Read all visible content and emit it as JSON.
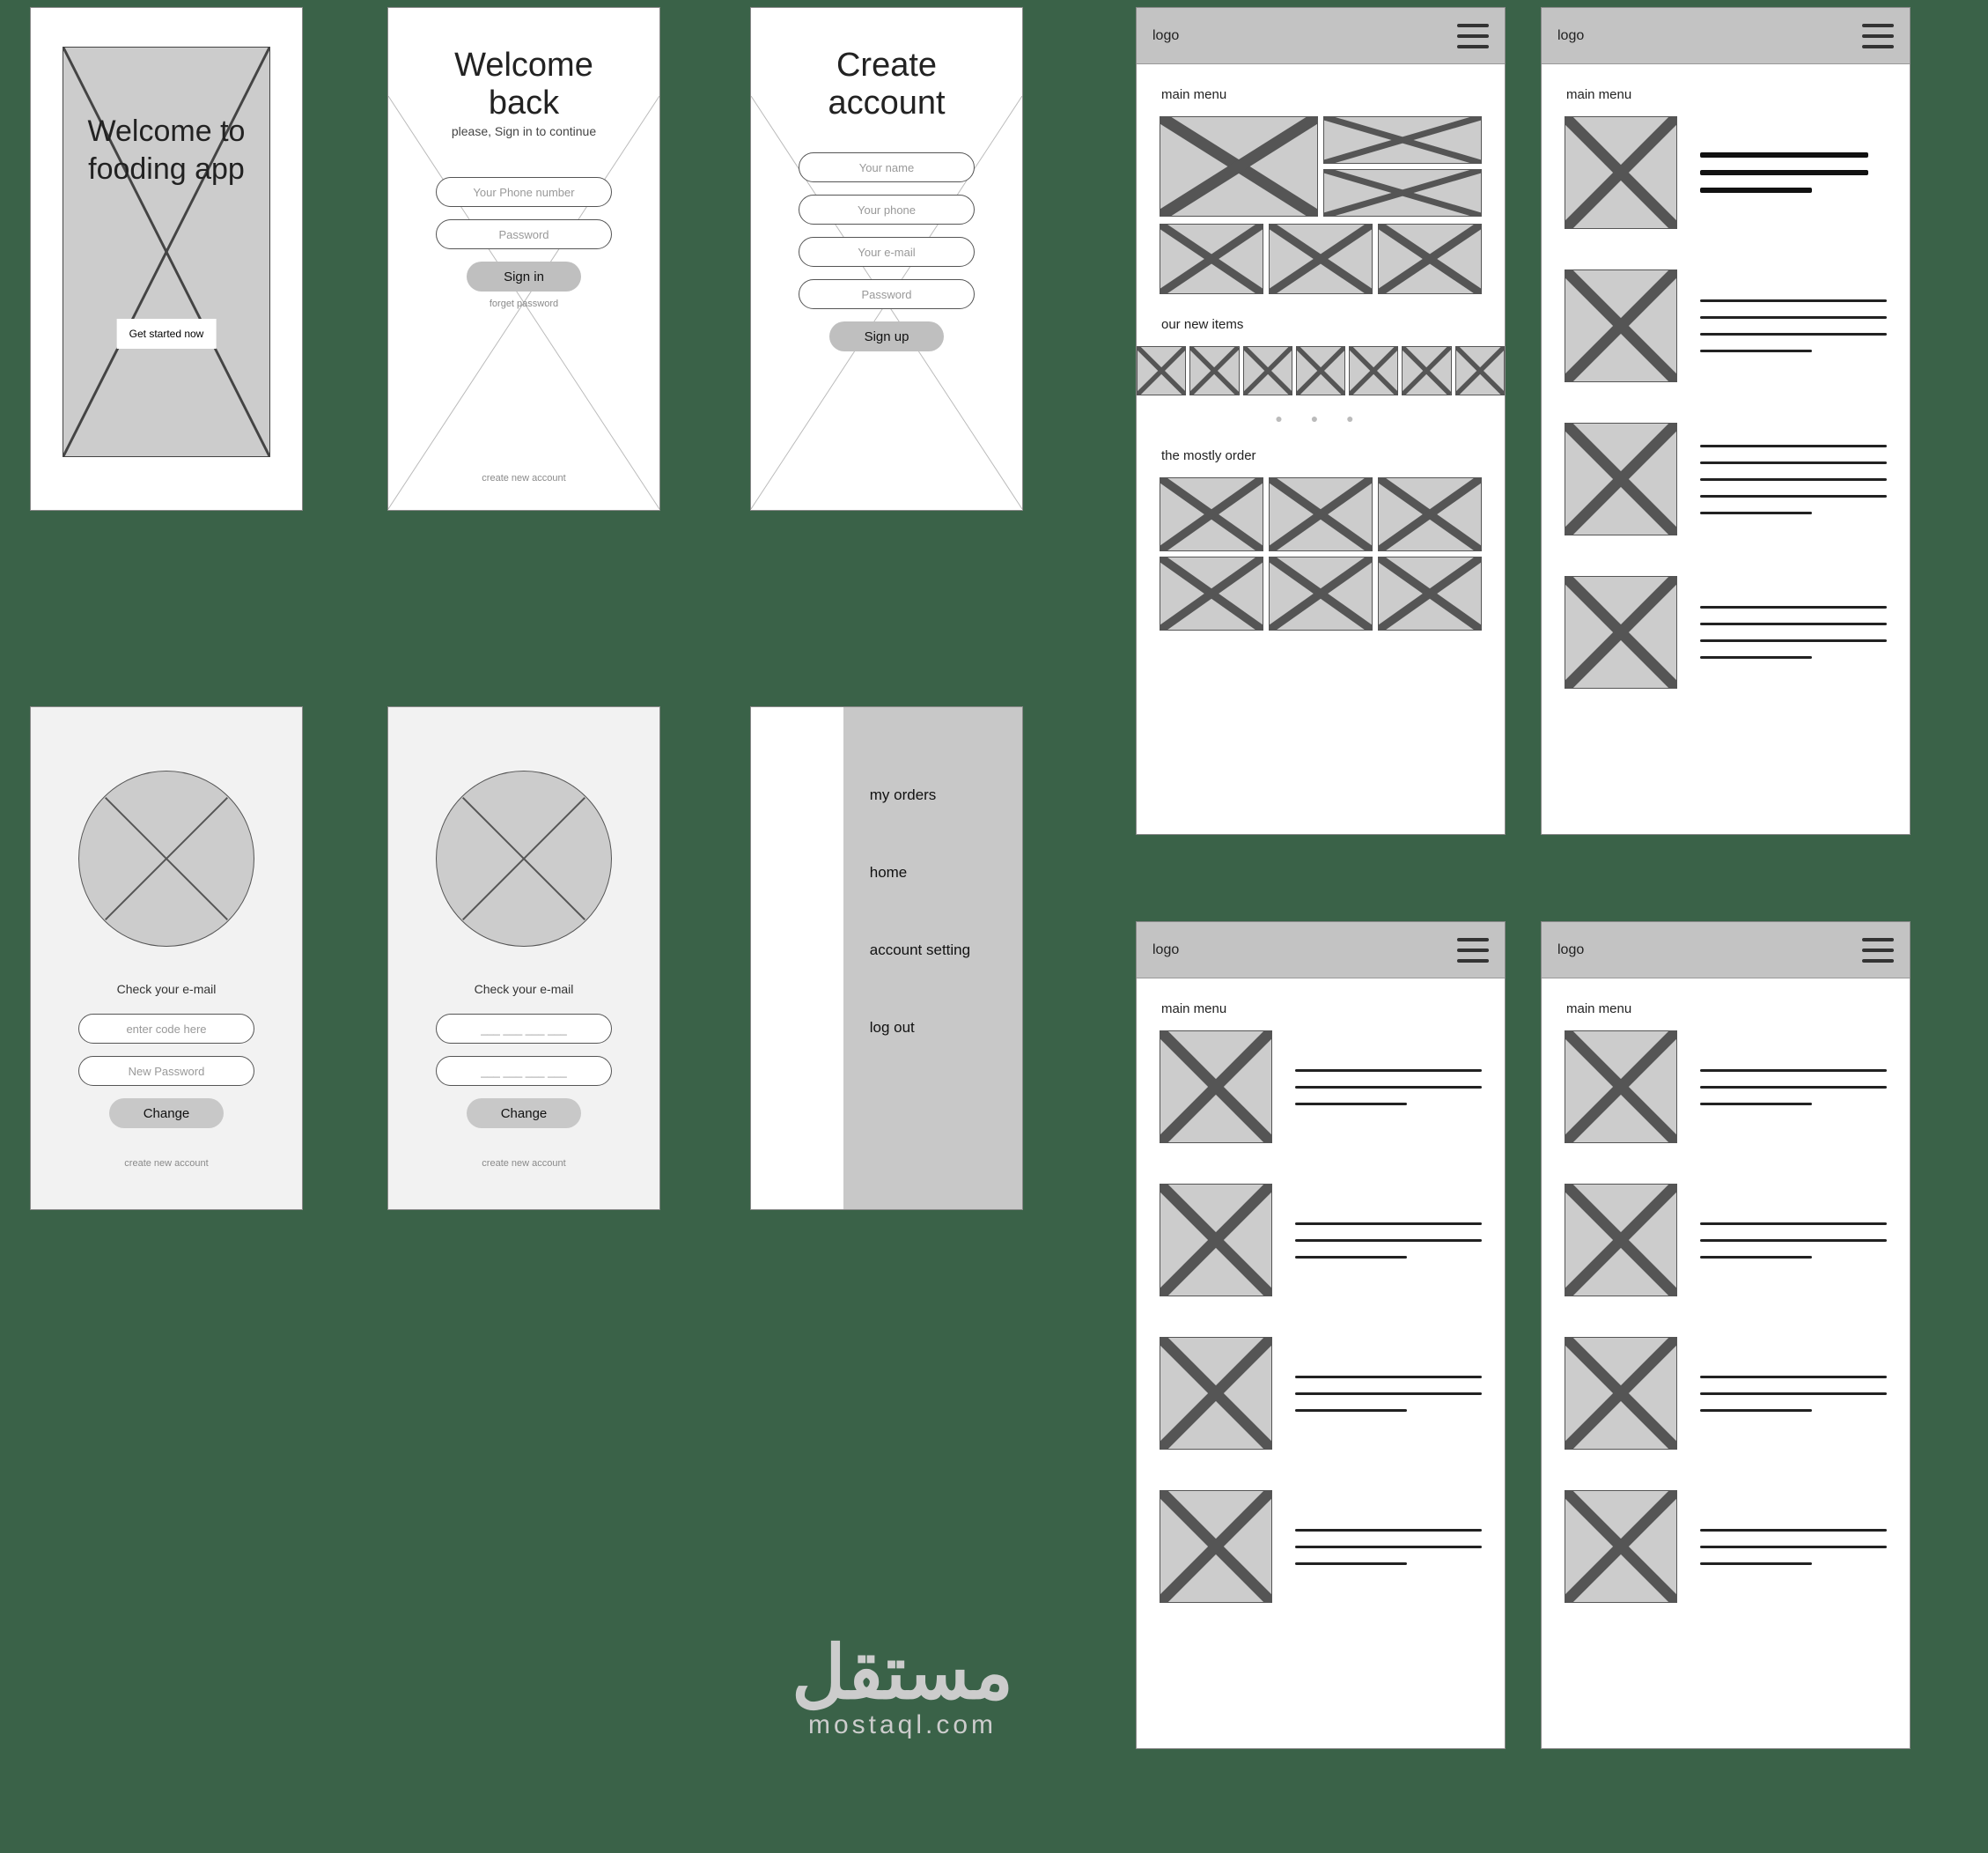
{
  "welcome": {
    "title_l1": "Welcome to",
    "title_l2": "fooding app",
    "cta": "Get started now"
  },
  "signin": {
    "title": "Welcome back",
    "subtitle": "please, Sign in to continue",
    "phone_ph": "Your  Phone number",
    "password_ph": "Password",
    "submit": "Sign in",
    "forgot": "forget password",
    "create": "create new account"
  },
  "signup": {
    "title": "Create account",
    "name_ph": "Your  name",
    "phone_ph": "Your  phone",
    "email_ph": "Your e-mail",
    "password_ph": "Password",
    "submit": "Sign up"
  },
  "verify1": {
    "label": "Check your e-mail",
    "code_ph": "enter code here",
    "newpass_ph": "New Password",
    "submit": "Change",
    "footer": "create new account"
  },
  "verify2": {
    "label": "Check your e-mail",
    "code_ph": "___  ___  ___  ___",
    "newpass_ph": "___  ___  ___  ___",
    "submit": "Change",
    "footer": "create new account"
  },
  "drawer": {
    "items": [
      "my orders",
      "home",
      "account setting",
      "log out"
    ]
  },
  "home": {
    "logo": "logo",
    "section1": "main menu",
    "section2": "our new items",
    "section3": "the mostly order"
  },
  "list": {
    "logo": "logo",
    "section": "main menu"
  },
  "watermark": {
    "ar": "مستقل",
    "en": "mostaql.com"
  }
}
